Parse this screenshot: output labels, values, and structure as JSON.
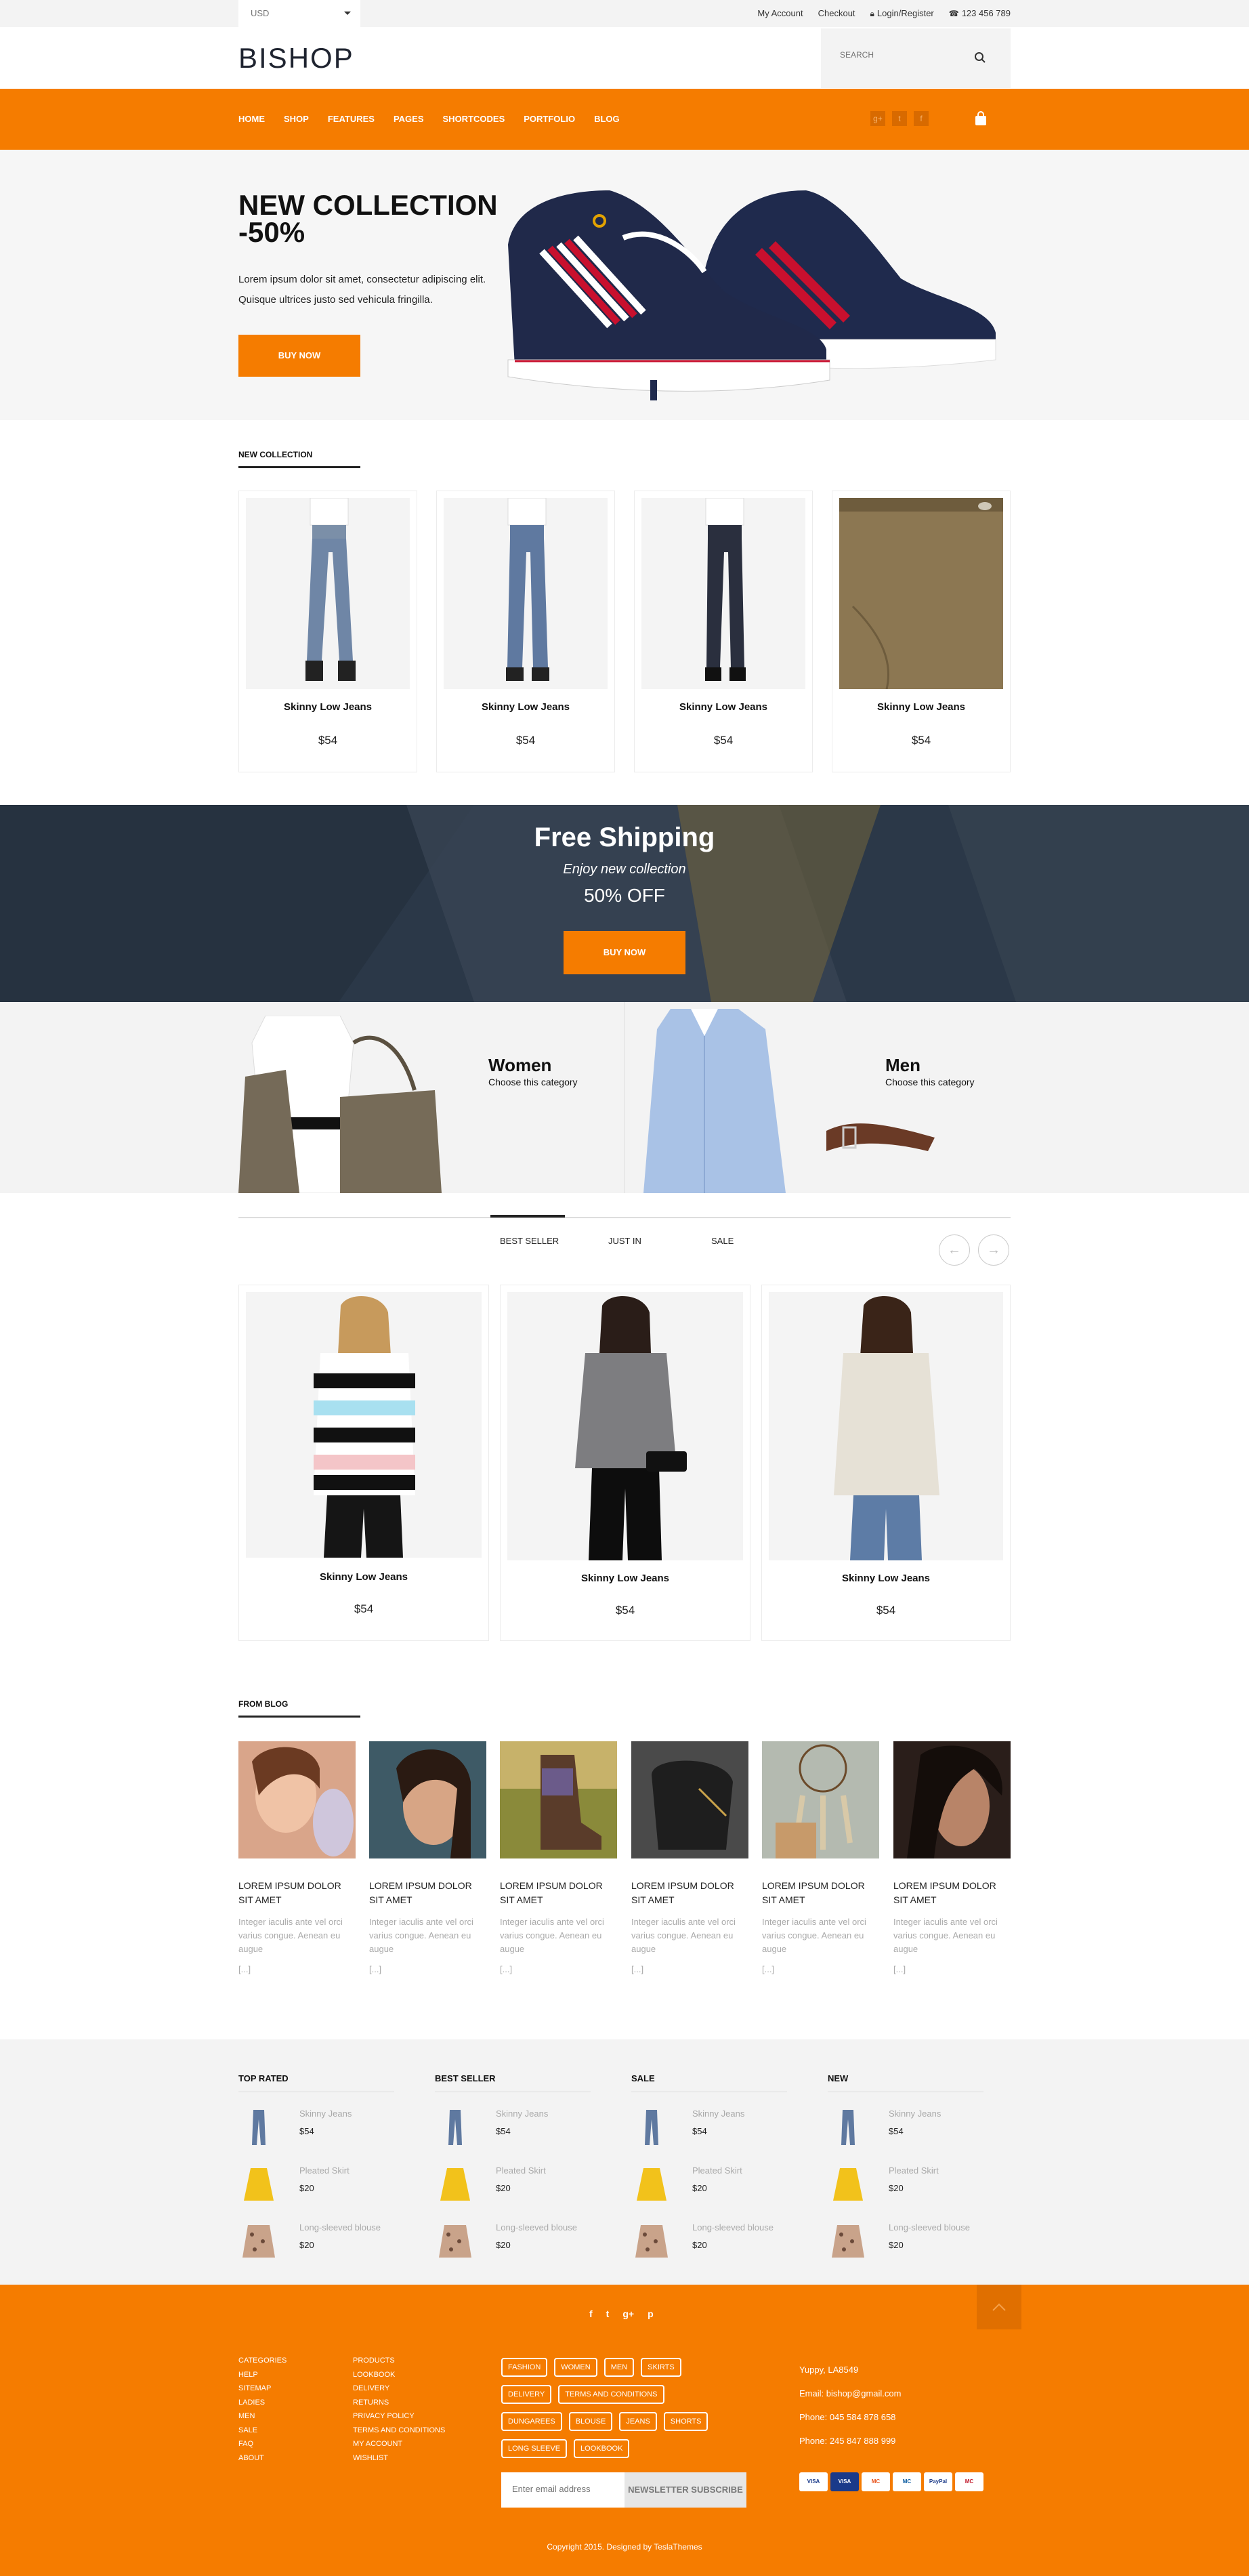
{
  "topbar": {
    "currency": "USD",
    "links": [
      {
        "label": "My Account"
      },
      {
        "label": "Checkout"
      },
      {
        "label": "Login/Register"
      },
      {
        "label": "123 456 789"
      }
    ]
  },
  "header": {
    "logo": "BISHOP",
    "search_placeholder": "SEARCH"
  },
  "nav": {
    "items": [
      "HOME",
      "SHOP",
      "FEATURES",
      "PAGES",
      "SHORTCODES",
      "PORTFOLIO",
      "BLOG"
    ],
    "active": "HOME",
    "socials": [
      "g+",
      "t",
      "f"
    ]
  },
  "hero": {
    "title_line1": "NEW COLLECTION",
    "title_line2": "-50%",
    "text_line1": "Lorem ipsum dolor sit amet, consectetur adipiscing elit.",
    "text_line2": "Quisque ultrices justo sed vehicula fringilla.",
    "button": "BUY NOW"
  },
  "new_collection": {
    "title": "NEW COLLECTION",
    "products": [
      {
        "name": "Skinny Low Jeans",
        "price": "$54"
      },
      {
        "name": "Skinny Low Jeans",
        "price": "$54"
      },
      {
        "name": "Skinny Low Jeans",
        "price": "$54"
      },
      {
        "name": "Skinny Low Jeans",
        "price": "$54"
      }
    ]
  },
  "shipping": {
    "title": "Free Shipping",
    "subtitle": "Enjoy new collection",
    "offer": "50% OFF",
    "button": "BUY NOW"
  },
  "categories": [
    {
      "title": "Women",
      "subtitle": "Choose this category"
    },
    {
      "title": "Men",
      "subtitle": "Choose this category"
    }
  ],
  "tabs": {
    "items": [
      "BEST SELLER",
      "JUST IN",
      "SALE"
    ],
    "active": "BEST SELLER",
    "prev": "←",
    "next": "→",
    "products": [
      {
        "name": "Skinny Low Jeans",
        "price": "$54"
      },
      {
        "name": "Skinny Low Jeans",
        "price": "$54"
      },
      {
        "name": "Skinny Low Jeans",
        "price": "$54"
      }
    ]
  },
  "blog": {
    "title": "FROM BLOG",
    "posts": [
      {
        "title": "LOREM IPSUM DOLOR SIT AMET",
        "excerpt": "Integer iaculis ante vel orci varius congue. Aenean eu augue",
        "more": "[...]"
      },
      {
        "title": "LOREM IPSUM DOLOR SIT AMET",
        "excerpt": "Integer iaculis ante vel orci varius congue. Aenean eu augue",
        "more": "[...]"
      },
      {
        "title": "LOREM IPSUM DOLOR SIT AMET",
        "excerpt": "Integer iaculis ante vel orci varius congue. Aenean eu augue",
        "more": "[...]"
      },
      {
        "title": "LOREM IPSUM DOLOR SIT AMET",
        "excerpt": "Integer iaculis ante vel orci varius congue. Aenean eu augue",
        "more": "[...]"
      },
      {
        "title": "LOREM IPSUM DOLOR SIT AMET",
        "excerpt": "Integer iaculis ante vel orci varius congue. Aenean eu augue",
        "more": "[...]"
      },
      {
        "title": "LOREM IPSUM DOLOR SIT AMET",
        "excerpt": "Integer iaculis ante vel orci varius congue. Aenean eu augue",
        "more": "[...]"
      }
    ]
  },
  "widgets": [
    {
      "title": "TOP RATED",
      "items": [
        {
          "name": "Skinny Jeans",
          "price": "$54"
        },
        {
          "name": "Pleated Skirt",
          "price": "$20"
        },
        {
          "name": "Long-sleeved blouse",
          "price": "$20"
        }
      ]
    },
    {
      "title": "BEST SELLER",
      "items": [
        {
          "name": "Skinny Jeans",
          "price": "$54"
        },
        {
          "name": "Pleated Skirt",
          "price": "$20"
        },
        {
          "name": "Long-sleeved blouse",
          "price": "$20"
        }
      ]
    },
    {
      "title": "SALE",
      "items": [
        {
          "name": "Skinny Jeans",
          "price": "$54"
        },
        {
          "name": "Pleated Skirt",
          "price": "$20"
        },
        {
          "name": "Long-sleeved blouse",
          "price": "$20"
        }
      ]
    },
    {
      "title": "NEW",
      "items": [
        {
          "name": "Skinny Jeans",
          "price": "$54"
        },
        {
          "name": "Pleated Skirt",
          "price": "$20"
        },
        {
          "name": "Long-sleeved blouse",
          "price": "$20"
        }
      ]
    }
  ],
  "footer": {
    "socials": [
      "f",
      "t",
      "g+",
      "p"
    ],
    "links_col1": [
      "CATEGORIES",
      "HELP",
      "SITEMAP",
      "LADIES",
      "MEN",
      "SALE",
      "FAQ",
      "ABOUT"
    ],
    "links_col2": [
      "PRODUCTS",
      "LOOKBOOK",
      "DELIVERY",
      "RETURNS",
      "PRIVACY POLICY",
      "TERMS AND CONDITIONS",
      "MY ACCOUNT",
      "WISHLIST"
    ],
    "tags": [
      "FASHION",
      "WOMEN",
      "MEN",
      "SKIRTS",
      "DELIVERY",
      "TERMS AND CONDITIONS",
      "DUNGAREES",
      "BLOUSE",
      "JEANS",
      "SHORTS",
      "LONG SLEEVE",
      "LOOKBOOK"
    ],
    "newsletter_placeholder": "Enter email address",
    "newsletter_button": "NEWSLETTER SUBSCRIBE",
    "address": "Yuppy, LA8549",
    "email": "Email: bishop@gmail.com",
    "phone1": "Phone: 045 584 878 658",
    "phone2": "Phone: 245 847 888 999",
    "payment_cards": [
      "VISA",
      "VISA",
      "MC",
      "MC",
      "PayPal",
      "MC"
    ],
    "copyright": "Copyright 2015. Designed by TeslaThemes"
  },
  "colors": {
    "accent": "#f57c00",
    "accent_dark": "#e06f00",
    "dark": "#2b3848"
  }
}
